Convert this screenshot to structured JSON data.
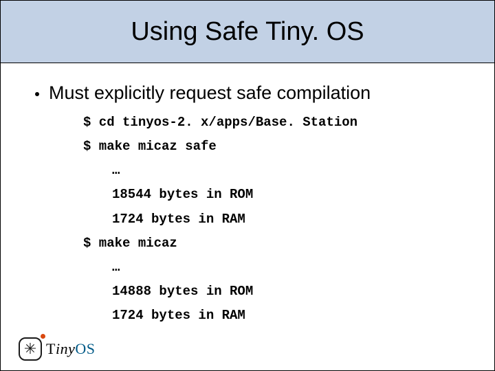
{
  "title": "Using Safe Tiny. OS",
  "bullet": "Must explicitly request safe compilation",
  "code": {
    "l0": "$ cd tinyos-2. x/apps/Base. Station",
    "l1": "$ make micaz safe",
    "l2": "…",
    "l3": "18544 bytes in ROM",
    "l4": "1724 bytes in RAM",
    "l5": "$ make micaz",
    "l6": "…",
    "l7": "14888 bytes in ROM",
    "l8": "1724 bytes in RAM"
  },
  "logo": {
    "t": "T",
    "iny": "iny",
    "os": "OS"
  }
}
